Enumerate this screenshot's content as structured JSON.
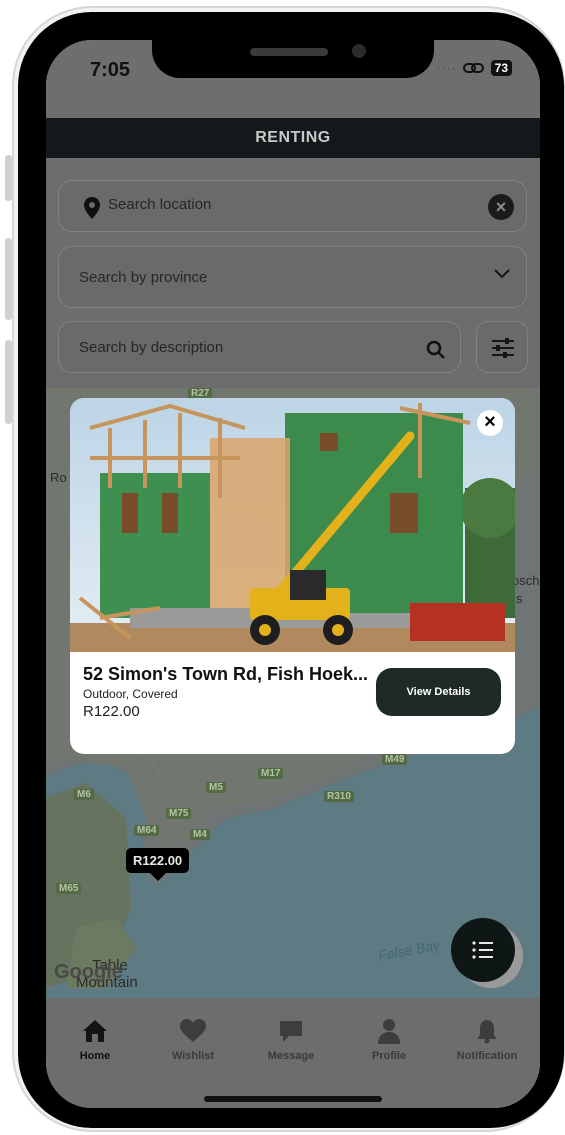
{
  "status_bar": {
    "time": "7:05",
    "battery": "73"
  },
  "header": {
    "title": "RENTING"
  },
  "search": {
    "location_placeholder": "Search location",
    "province_placeholder": "Search by province",
    "description_placeholder": "Search by description"
  },
  "map": {
    "road_labels": [
      "R27",
      "M17",
      "M5",
      "M49",
      "M6",
      "M75",
      "M64",
      "M4",
      "R310",
      "M65"
    ],
    "place_labels": [
      "Ro",
      "osch",
      "s",
      "Table",
      "Mountain"
    ],
    "bay_label": "False Bay",
    "google_logo": "Google",
    "price_marker": "R122.00"
  },
  "listing_card": {
    "title": "52 Simon's Town Rd, Fish Hoek...",
    "subtitle": "Outdoor, Covered",
    "price": "R122.00",
    "view_details_label": "View Details"
  },
  "tabbar": {
    "items": [
      {
        "label": "Home",
        "icon": "home-icon",
        "active": true
      },
      {
        "label": "Wishlist",
        "icon": "heart-icon",
        "active": false
      },
      {
        "label": "Message",
        "icon": "chat-bubble-icon",
        "active": false
      },
      {
        "label": "Profile",
        "icon": "person-icon",
        "active": false
      },
      {
        "label": "Notification",
        "icon": "bell-icon",
        "active": false
      }
    ]
  },
  "colors": {
    "header_bg": "#13191a",
    "button_bg": "#1d2a28",
    "overlay": "#6d6d6d"
  }
}
